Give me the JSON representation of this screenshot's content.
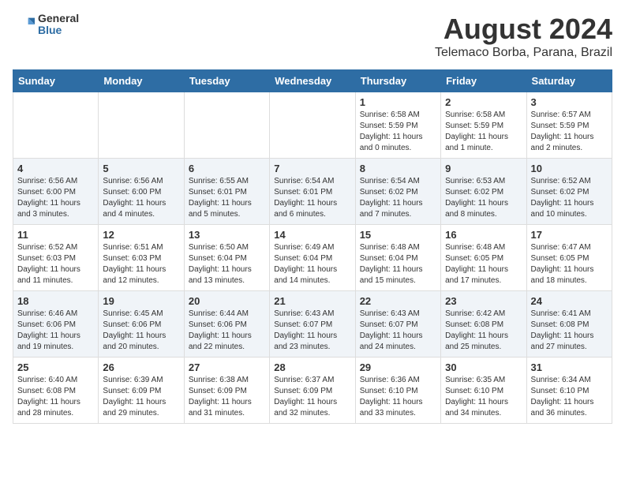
{
  "logo": {
    "general": "General",
    "blue": "Blue"
  },
  "title": "August 2024",
  "subtitle": "Telemaco Borba, Parana, Brazil",
  "days_of_week": [
    "Sunday",
    "Monday",
    "Tuesday",
    "Wednesday",
    "Thursday",
    "Friday",
    "Saturday"
  ],
  "weeks": [
    [
      {
        "day": "",
        "info": ""
      },
      {
        "day": "",
        "info": ""
      },
      {
        "day": "",
        "info": ""
      },
      {
        "day": "",
        "info": ""
      },
      {
        "day": "1",
        "info": "Sunrise: 6:58 AM\nSunset: 5:59 PM\nDaylight: 11 hours and 0 minutes."
      },
      {
        "day": "2",
        "info": "Sunrise: 6:58 AM\nSunset: 5:59 PM\nDaylight: 11 hours and 1 minute."
      },
      {
        "day": "3",
        "info": "Sunrise: 6:57 AM\nSunset: 5:59 PM\nDaylight: 11 hours and 2 minutes."
      }
    ],
    [
      {
        "day": "4",
        "info": "Sunrise: 6:56 AM\nSunset: 6:00 PM\nDaylight: 11 hours and 3 minutes."
      },
      {
        "day": "5",
        "info": "Sunrise: 6:56 AM\nSunset: 6:00 PM\nDaylight: 11 hours and 4 minutes."
      },
      {
        "day": "6",
        "info": "Sunrise: 6:55 AM\nSunset: 6:01 PM\nDaylight: 11 hours and 5 minutes."
      },
      {
        "day": "7",
        "info": "Sunrise: 6:54 AM\nSunset: 6:01 PM\nDaylight: 11 hours and 6 minutes."
      },
      {
        "day": "8",
        "info": "Sunrise: 6:54 AM\nSunset: 6:02 PM\nDaylight: 11 hours and 7 minutes."
      },
      {
        "day": "9",
        "info": "Sunrise: 6:53 AM\nSunset: 6:02 PM\nDaylight: 11 hours and 8 minutes."
      },
      {
        "day": "10",
        "info": "Sunrise: 6:52 AM\nSunset: 6:02 PM\nDaylight: 11 hours and 10 minutes."
      }
    ],
    [
      {
        "day": "11",
        "info": "Sunrise: 6:52 AM\nSunset: 6:03 PM\nDaylight: 11 hours and 11 minutes."
      },
      {
        "day": "12",
        "info": "Sunrise: 6:51 AM\nSunset: 6:03 PM\nDaylight: 11 hours and 12 minutes."
      },
      {
        "day": "13",
        "info": "Sunrise: 6:50 AM\nSunset: 6:04 PM\nDaylight: 11 hours and 13 minutes."
      },
      {
        "day": "14",
        "info": "Sunrise: 6:49 AM\nSunset: 6:04 PM\nDaylight: 11 hours and 14 minutes."
      },
      {
        "day": "15",
        "info": "Sunrise: 6:48 AM\nSunset: 6:04 PM\nDaylight: 11 hours and 15 minutes."
      },
      {
        "day": "16",
        "info": "Sunrise: 6:48 AM\nSunset: 6:05 PM\nDaylight: 11 hours and 17 minutes."
      },
      {
        "day": "17",
        "info": "Sunrise: 6:47 AM\nSunset: 6:05 PM\nDaylight: 11 hours and 18 minutes."
      }
    ],
    [
      {
        "day": "18",
        "info": "Sunrise: 6:46 AM\nSunset: 6:06 PM\nDaylight: 11 hours and 19 minutes."
      },
      {
        "day": "19",
        "info": "Sunrise: 6:45 AM\nSunset: 6:06 PM\nDaylight: 11 hours and 20 minutes."
      },
      {
        "day": "20",
        "info": "Sunrise: 6:44 AM\nSunset: 6:06 PM\nDaylight: 11 hours and 22 minutes."
      },
      {
        "day": "21",
        "info": "Sunrise: 6:43 AM\nSunset: 6:07 PM\nDaylight: 11 hours and 23 minutes."
      },
      {
        "day": "22",
        "info": "Sunrise: 6:43 AM\nSunset: 6:07 PM\nDaylight: 11 hours and 24 minutes."
      },
      {
        "day": "23",
        "info": "Sunrise: 6:42 AM\nSunset: 6:08 PM\nDaylight: 11 hours and 25 minutes."
      },
      {
        "day": "24",
        "info": "Sunrise: 6:41 AM\nSunset: 6:08 PM\nDaylight: 11 hours and 27 minutes."
      }
    ],
    [
      {
        "day": "25",
        "info": "Sunrise: 6:40 AM\nSunset: 6:08 PM\nDaylight: 11 hours and 28 minutes."
      },
      {
        "day": "26",
        "info": "Sunrise: 6:39 AM\nSunset: 6:09 PM\nDaylight: 11 hours and 29 minutes."
      },
      {
        "day": "27",
        "info": "Sunrise: 6:38 AM\nSunset: 6:09 PM\nDaylight: 11 hours and 31 minutes."
      },
      {
        "day": "28",
        "info": "Sunrise: 6:37 AM\nSunset: 6:09 PM\nDaylight: 11 hours and 32 minutes."
      },
      {
        "day": "29",
        "info": "Sunrise: 6:36 AM\nSunset: 6:10 PM\nDaylight: 11 hours and 33 minutes."
      },
      {
        "day": "30",
        "info": "Sunrise: 6:35 AM\nSunset: 6:10 PM\nDaylight: 11 hours and 34 minutes."
      },
      {
        "day": "31",
        "info": "Sunrise: 6:34 AM\nSunset: 6:10 PM\nDaylight: 11 hours and 36 minutes."
      }
    ]
  ]
}
